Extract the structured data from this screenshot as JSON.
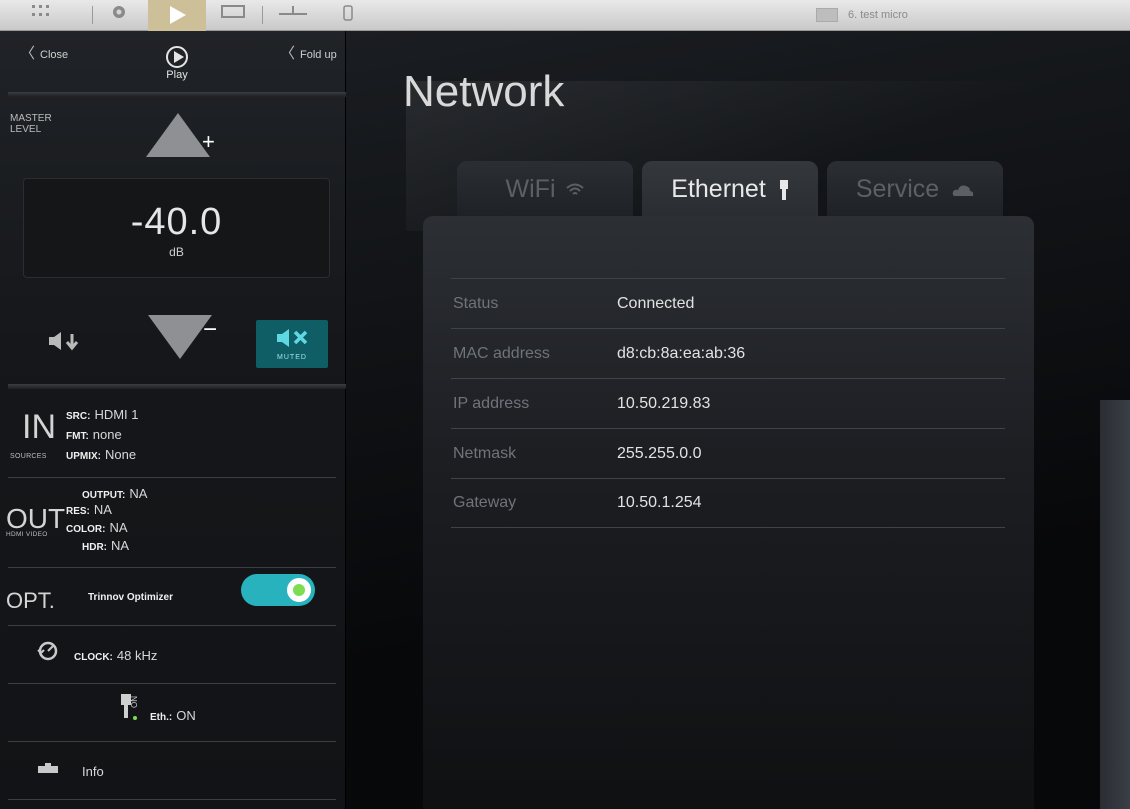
{
  "toolbar": {
    "preset_label": "6. test micro",
    "icons": [
      "menu-grid-icon",
      "settings-icon",
      "play-icon",
      "monitor-icon",
      "network-icon",
      "phone-icon"
    ]
  },
  "left_panel": {
    "close_label": "Close",
    "foldup_label": "Fold up",
    "play_label": "Play",
    "master_level_label": "MASTER LEVEL",
    "level_value": "-40.0",
    "level_unit": "dB",
    "muted_label": "MUTED",
    "inputs": {
      "big": "IN",
      "sub": "SOURCES",
      "src_key": "SRC:",
      "src_val": "HDMI 1",
      "fmt_key": "FMT:",
      "fmt_val": "none",
      "upmix_key": "UPMIX:",
      "upmix_val": "None"
    },
    "outputs": {
      "big": "OUT",
      "sub": "HDMI VIDEO",
      "output_key": "OUTPUT:",
      "output_val": "NA",
      "res_key": "RES:",
      "res_val": "NA",
      "color_key": "COLOR:",
      "color_val": "NA",
      "hdr_key": "HDR:",
      "hdr_val": "NA"
    },
    "optimizer": {
      "big": "OPT.",
      "label": "Trinnov Optimizer",
      "enabled": true
    },
    "clock": {
      "key": "CLOCK:",
      "val": "48 kHz"
    },
    "ethernet": {
      "key": "Eth.:",
      "val": "ON",
      "icon_text": "ON"
    },
    "info_label": "Info"
  },
  "main": {
    "title": "Network",
    "tabs": [
      {
        "label": "WiFi",
        "icon": "wifi-icon",
        "active": false
      },
      {
        "label": "Ethernet",
        "icon": "ethernet-plug-icon",
        "active": true
      },
      {
        "label": "Service",
        "icon": "cloud-icon",
        "active": false
      }
    ],
    "rows": [
      {
        "key": "Status",
        "value": "Connected"
      },
      {
        "key": "MAC address",
        "value": "d8:cb:8a:ea:ab:36"
      },
      {
        "key": "IP address",
        "value": "10.50.219.83"
      },
      {
        "key": "Netmask",
        "value": "255.255.0.0"
      },
      {
        "key": "Gateway",
        "value": "10.50.1.254"
      }
    ]
  },
  "colors": {
    "accent_teal": "#27b2be",
    "mute_bg": "#0f5e66",
    "toggle_knob_dot": "#7ddc52",
    "active_play_tab": "#cdbf98"
  }
}
